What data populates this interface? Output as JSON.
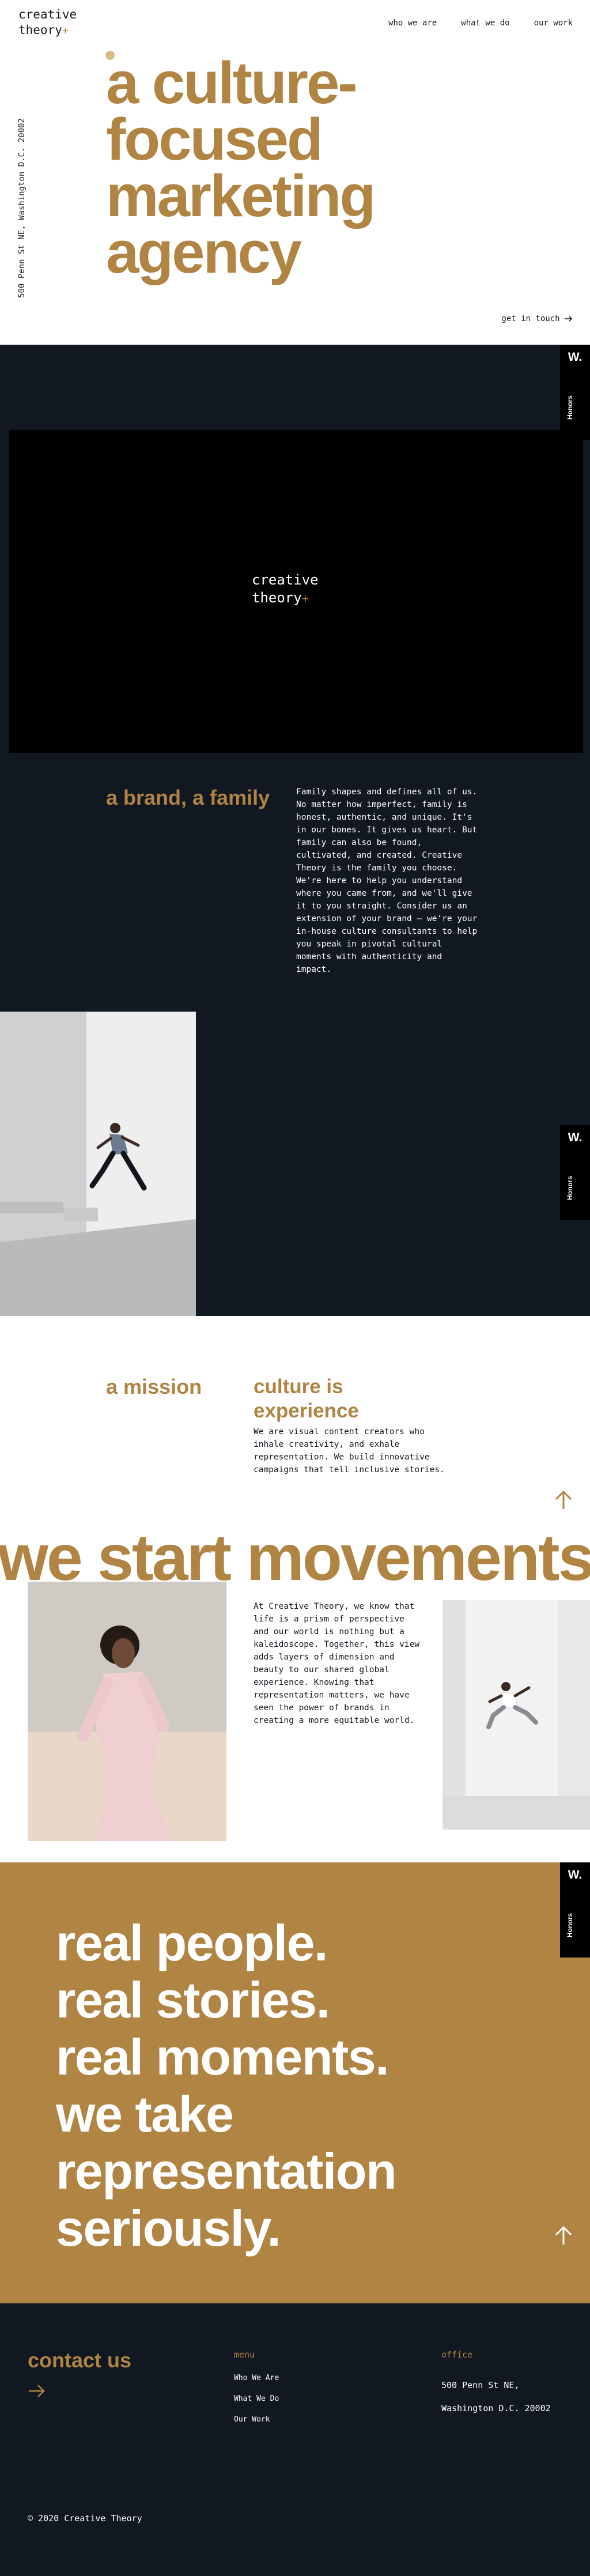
{
  "header": {
    "logo_line1": "creative",
    "logo_line2": "theory",
    "logo_plus": "+",
    "nav": [
      "who we are",
      "what we do",
      "our work"
    ]
  },
  "hero": {
    "address": "500 Penn St NE, Washington D.C. 20002",
    "title": "a culture-focused marketing agency",
    "cta": "get in touch"
  },
  "magazine_tab": {
    "letter": "W.",
    "label": "Honors"
  },
  "video": {
    "logo_line1": "creative",
    "logo_line2": "theory",
    "logo_plus": "+"
  },
  "brand": {
    "heading": "a brand, a family",
    "text": "Family shapes and defines all of us. No matter how imperfect, family is honest, authentic, and unique. It's in our bones. It gives us heart. But family can also be found, cultivated, and created. Creative Theory is the family you choose. We're here to help you understand where you came from, and we'll give it to you straight. Consider us an extension of your brand — we're your in-house culture consultants to help you speak in pivotal cultural moments with authenticity and impact."
  },
  "mission": {
    "heading": "a mission",
    "culture_heading": "culture is experience",
    "culture_text": "We are visual content creators who inhale creativity, and exhale representation. We build innovative campaigns that tell inclusive stories.",
    "movements": "we start movements",
    "movements_text": "At Creative Theory, we know that life is a prism of perspective and our world is nothing but a kaleidoscope. Together, this view adds layers of dimension and beauty to our shared global experience. Knowing that representation matters, we have seen the power of brands in creating a more equitable world."
  },
  "statement": {
    "lines": [
      "real people.",
      "real stories.",
      "real moments.",
      "we take representation seriously."
    ]
  },
  "footer": {
    "contact_heading": "contact us",
    "menu_label": "menu",
    "menu_items": [
      "Who We Are",
      "What We Do",
      "Our Work"
    ],
    "office_label": "office",
    "office_line1": "500 Penn St NE,",
    "office_line2": "Washington D.C. 20002",
    "copyright": "© 2020 Creative Theory"
  },
  "colors": {
    "gold": "#b08442",
    "navy": "#121821",
    "white": "#ffffff"
  }
}
